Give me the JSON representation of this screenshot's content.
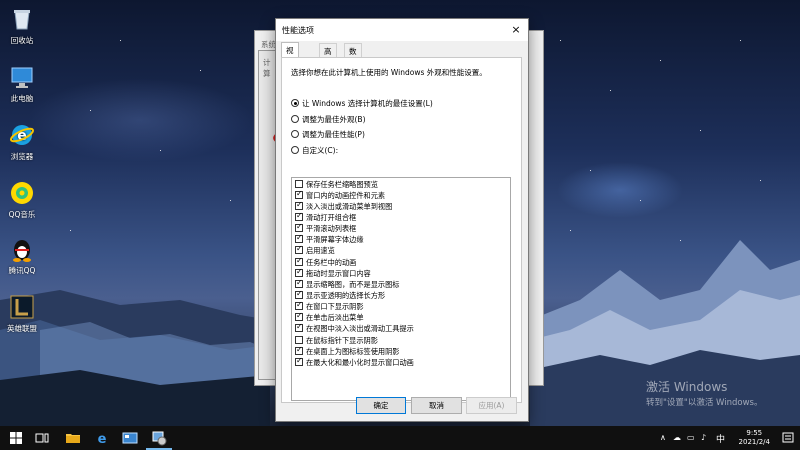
{
  "desktop_icons": [
    {
      "label": "回收站",
      "icon": "recycle-bin-icon"
    },
    {
      "label": "此电脑",
      "icon": "this-pc-icon"
    },
    {
      "label": "浏览器",
      "icon": "ie-browser-icon"
    },
    {
      "label": "QQ音乐",
      "icon": "qq-music-icon"
    },
    {
      "label": "腾讯QQ",
      "icon": "qq-penguin-icon"
    },
    {
      "label": "英雄联盟",
      "icon": "league-of-legends-icon"
    }
  ],
  "bg_window": {
    "title_1": "系统",
    "title_2": "计算"
  },
  "dialog": {
    "title": "性能选项",
    "close": "×",
    "tabs": [
      "视觉效果",
      "高级",
      "数据执行保护"
    ],
    "description": "选择你想在此计算机上使用的 Windows 外观和性能设置。",
    "radios": [
      {
        "label": "让 Windows 选择计算机的最佳设置(L)",
        "selected": true
      },
      {
        "label": "调整为最佳外观(B)",
        "selected": false
      },
      {
        "label": "调整为最佳性能(P)",
        "selected": false
      },
      {
        "label": "自定义(C):",
        "selected": false
      }
    ],
    "options": [
      {
        "label": "保存任务栏缩略图预览",
        "checked": false
      },
      {
        "label": "窗口内的动画控件和元素",
        "checked": true
      },
      {
        "label": "淡入淡出或滑动菜单到视图",
        "checked": true
      },
      {
        "label": "滑动打开组合框",
        "checked": true
      },
      {
        "label": "平滑滚动列表框",
        "checked": true
      },
      {
        "label": "平滑屏幕字体边缘",
        "checked": true
      },
      {
        "label": "启用速览",
        "checked": true
      },
      {
        "label": "任务栏中的动画",
        "checked": true
      },
      {
        "label": "拖动时显示窗口内容",
        "checked": true
      },
      {
        "label": "显示缩略图，而不是显示图标",
        "checked": true
      },
      {
        "label": "显示亚透明的选择长方形",
        "checked": true
      },
      {
        "label": "在窗口下显示阴影",
        "checked": true
      },
      {
        "label": "在单击后淡出菜单",
        "checked": true
      },
      {
        "label": "在视图中淡入淡出或滑动工具提示",
        "checked": true
      },
      {
        "label": "在鼠标指针下显示阴影",
        "checked": false
      },
      {
        "label": "在桌面上为图标标签使用阴影",
        "checked": true
      },
      {
        "label": "在最大化和最小化时显示窗口动画",
        "checked": true
      }
    ],
    "buttons": {
      "ok": "确定",
      "cancel": "取消",
      "apply": "应用(A)"
    }
  },
  "watermark": {
    "line1": "激活 Windows",
    "line2": "转到\"设置\"以激活 Windows。"
  },
  "taskbar": {
    "icons": [
      "windows-start-icon",
      "task-view-icon",
      "file-explorer-icon",
      "edge-icon",
      "control-panel-icon",
      "system-settings-icon"
    ],
    "ime": "中",
    "time": "9:55",
    "date": "2021/2/4"
  },
  "colors": {
    "accent": "#0078d7",
    "annotation": "#d42020",
    "taskbar": "#101010"
  }
}
